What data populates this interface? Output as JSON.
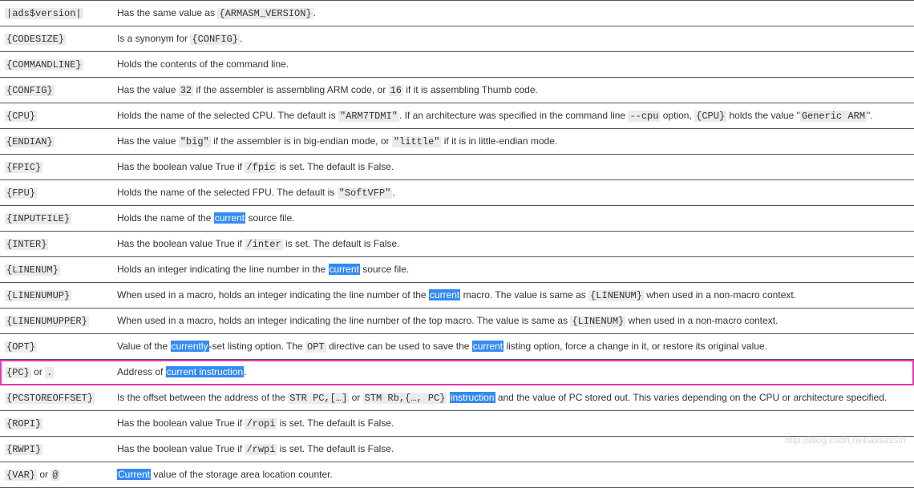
{
  "rows": [
    {
      "var_segments": [
        {
          "t": "code",
          "v": "|ads$version|"
        }
      ],
      "desc_segments": [
        {
          "t": "text",
          "v": "Has the same value as "
        },
        {
          "t": "code",
          "v": "{ARMASM_VERSION}"
        },
        {
          "t": "text",
          "v": "."
        }
      ]
    },
    {
      "var_segments": [
        {
          "t": "code",
          "v": "{CODESIZE}"
        }
      ],
      "desc_segments": [
        {
          "t": "text",
          "v": "Is a synonym for "
        },
        {
          "t": "code",
          "v": "{CONFIG}"
        },
        {
          "t": "text",
          "v": "."
        }
      ]
    },
    {
      "var_segments": [
        {
          "t": "code",
          "v": "{COMMANDLINE}"
        }
      ],
      "desc_segments": [
        {
          "t": "text",
          "v": "Holds the contents of the command line."
        }
      ]
    },
    {
      "var_segments": [
        {
          "t": "code",
          "v": "{CONFIG}"
        }
      ],
      "desc_segments": [
        {
          "t": "text",
          "v": "Has the value "
        },
        {
          "t": "code",
          "v": "32"
        },
        {
          "t": "text",
          "v": " if the assembler is assembling ARM code, or "
        },
        {
          "t": "code",
          "v": "16"
        },
        {
          "t": "text",
          "v": " if it is assembling Thumb code."
        }
      ]
    },
    {
      "var_segments": [
        {
          "t": "code",
          "v": "{CPU}"
        }
      ],
      "desc_segments": [
        {
          "t": "text",
          "v": "Holds the name of the selected CPU. The default is "
        },
        {
          "t": "code",
          "v": "\"ARM7TDMI\""
        },
        {
          "t": "text",
          "v": ". If an architecture was specified in the command line "
        },
        {
          "t": "code",
          "v": "--cpu"
        },
        {
          "t": "text",
          "v": " option, "
        },
        {
          "t": "code",
          "v": "{CPU}"
        },
        {
          "t": "text",
          "v": " holds the value \""
        },
        {
          "t": "code",
          "v": "Generic ARM"
        },
        {
          "t": "text",
          "v": "\"."
        }
      ]
    },
    {
      "var_segments": [
        {
          "t": "code",
          "v": "{ENDIAN}"
        }
      ],
      "desc_segments": [
        {
          "t": "text",
          "v": "Has the value "
        },
        {
          "t": "code",
          "v": "\"big\""
        },
        {
          "t": "text",
          "v": " if the assembler is in big-endian mode, or "
        },
        {
          "t": "code",
          "v": "\"little\""
        },
        {
          "t": "text",
          "v": " if it is in little-endian mode."
        }
      ]
    },
    {
      "var_segments": [
        {
          "t": "code",
          "v": "{FPIC}"
        }
      ],
      "desc_segments": [
        {
          "t": "text",
          "v": "Has the boolean value True if "
        },
        {
          "t": "code",
          "v": "/fpic"
        },
        {
          "t": "text",
          "v": " is set. The default is False."
        }
      ]
    },
    {
      "var_segments": [
        {
          "t": "code",
          "v": "{FPU}"
        }
      ],
      "desc_segments": [
        {
          "t": "text",
          "v": "Holds the name of the selected FPU. The default is "
        },
        {
          "t": "code",
          "v": "\"SoftVFP\""
        },
        {
          "t": "text",
          "v": "."
        }
      ]
    },
    {
      "var_segments": [
        {
          "t": "code",
          "v": "{INPUTFILE}"
        }
      ],
      "desc_segments": [
        {
          "t": "text",
          "v": "Holds the name of the "
        },
        {
          "t": "hl",
          "v": "current"
        },
        {
          "t": "text",
          "v": " source file."
        }
      ]
    },
    {
      "var_segments": [
        {
          "t": "code",
          "v": "{INTER}"
        }
      ],
      "desc_segments": [
        {
          "t": "text",
          "v": "Has the boolean value True if "
        },
        {
          "t": "code",
          "v": "/inter"
        },
        {
          "t": "text",
          "v": " is set. The default is False."
        }
      ]
    },
    {
      "var_segments": [
        {
          "t": "code",
          "v": "{LINENUM}"
        }
      ],
      "desc_segments": [
        {
          "t": "text",
          "v": "Holds an integer indicating the line number in the "
        },
        {
          "t": "hl",
          "v": "current"
        },
        {
          "t": "text",
          "v": " source file."
        }
      ]
    },
    {
      "var_segments": [
        {
          "t": "code",
          "v": "{LINENUMUP}"
        }
      ],
      "desc_segments": [
        {
          "t": "text",
          "v": "When used in a macro, holds an integer indicating the line number of the "
        },
        {
          "t": "hl",
          "v": "current"
        },
        {
          "t": "text",
          "v": " macro. The value is same as "
        },
        {
          "t": "code",
          "v": "{LINENUM}"
        },
        {
          "t": "text",
          "v": " when used in a non-macro context."
        }
      ]
    },
    {
      "var_segments": [
        {
          "t": "code",
          "v": "{LINENUMUPPER}"
        }
      ],
      "desc_segments": [
        {
          "t": "text",
          "v": "When used in a macro, holds an integer indicating the line number of the top macro. The value is same as "
        },
        {
          "t": "code",
          "v": "{LINENUM}"
        },
        {
          "t": "text",
          "v": " when used in a non-macro context."
        }
      ]
    },
    {
      "var_segments": [
        {
          "t": "code",
          "v": "{OPT}"
        }
      ],
      "desc_segments": [
        {
          "t": "text",
          "v": "Value of the "
        },
        {
          "t": "hl",
          "v": "currently"
        },
        {
          "t": "text",
          "v": "-set listing option. The "
        },
        {
          "t": "code",
          "v": "OPT"
        },
        {
          "t": "text",
          "v": " directive can be used to save the "
        },
        {
          "t": "hl",
          "v": "current"
        },
        {
          "t": "text",
          "v": " listing option, force a change in it, or restore its original value."
        }
      ]
    },
    {
      "boxed": true,
      "var_segments": [
        {
          "t": "code",
          "v": "{PC}"
        },
        {
          "t": "text",
          "v": " or "
        },
        {
          "t": "code",
          "v": "."
        }
      ],
      "desc_segments": [
        {
          "t": "text",
          "v": "Address of "
        },
        {
          "t": "hl",
          "v": "current instruction"
        },
        {
          "t": "text",
          "v": "."
        }
      ]
    },
    {
      "var_segments": [
        {
          "t": "code",
          "v": "{PCSTOREOFFSET}"
        }
      ],
      "desc_segments": [
        {
          "t": "text",
          "v": "Is the offset between the address of the "
        },
        {
          "t": "code",
          "v": "STR PC,[…]"
        },
        {
          "t": "text",
          "v": " or "
        },
        {
          "t": "code",
          "v": "STM Rb,{…, PC}"
        },
        {
          "t": "text",
          "v": " "
        },
        {
          "t": "hl",
          "v": "instruction"
        },
        {
          "t": "text",
          "v": " and the value of PC stored out. This varies depending on the CPU or architecture specified."
        }
      ]
    },
    {
      "var_segments": [
        {
          "t": "code",
          "v": "{ROPI}"
        }
      ],
      "desc_segments": [
        {
          "t": "text",
          "v": "Has the boolean value True if "
        },
        {
          "t": "code",
          "v": "/ropi"
        },
        {
          "t": "text",
          "v": " is set. The default is False."
        }
      ]
    },
    {
      "var_segments": [
        {
          "t": "code",
          "v": "{RWPI}"
        }
      ],
      "desc_segments": [
        {
          "t": "text",
          "v": "Has the boolean value True if "
        },
        {
          "t": "code",
          "v": "/rwpi"
        },
        {
          "t": "text",
          "v": " is set. The default is False."
        }
      ]
    },
    {
      "var_segments": [
        {
          "t": "code",
          "v": "{VAR}"
        },
        {
          "t": "text",
          "v": " or "
        },
        {
          "t": "code",
          "v": "@"
        }
      ],
      "desc_segments": [
        {
          "t": "hl",
          "v": "Current"
        },
        {
          "t": "text",
          "v": " value of the storage area location counter."
        }
      ]
    }
  ],
  "watermark": "http://blog.csdn.net/assassin"
}
